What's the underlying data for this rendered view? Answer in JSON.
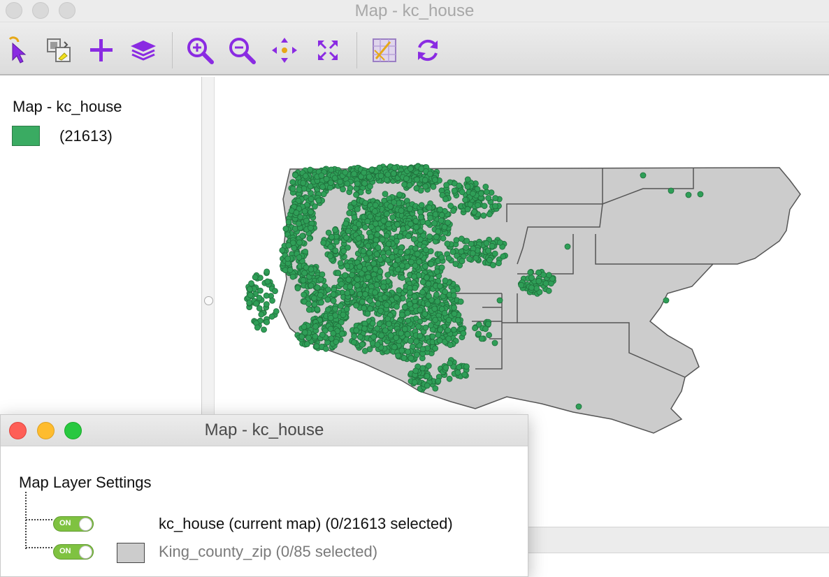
{
  "window": {
    "title": "Map - kc_house"
  },
  "toolbar": {
    "tools": [
      {
        "name": "select-icon"
      },
      {
        "name": "selection-mode-icon"
      },
      {
        "name": "add-layer-icon"
      },
      {
        "name": "layers-icon"
      },
      {
        "name": "zoom-in-icon"
      },
      {
        "name": "zoom-out-icon"
      },
      {
        "name": "pan-icon"
      },
      {
        "name": "full-extent-icon"
      },
      {
        "name": "basemap-icon"
      },
      {
        "name": "refresh-icon"
      }
    ]
  },
  "legend": {
    "title": "Map - kc_house",
    "count": "(21613)",
    "swatch_color": "#3aab62"
  },
  "map": {
    "polygon_fill": "#cccccc",
    "polygon_stroke": "#555555",
    "point_fill": "#2f9e57",
    "point_stroke": "#1f6e3b"
  },
  "layer_dialog": {
    "title": "Map - kc_house",
    "heading": "Map Layer Settings",
    "layers": [
      {
        "name": "kc_house (current map) (0/21613 selected)",
        "toggle": "ON"
      },
      {
        "name": "King_county_zip (0/85 selected)",
        "toggle": "ON"
      }
    ]
  }
}
